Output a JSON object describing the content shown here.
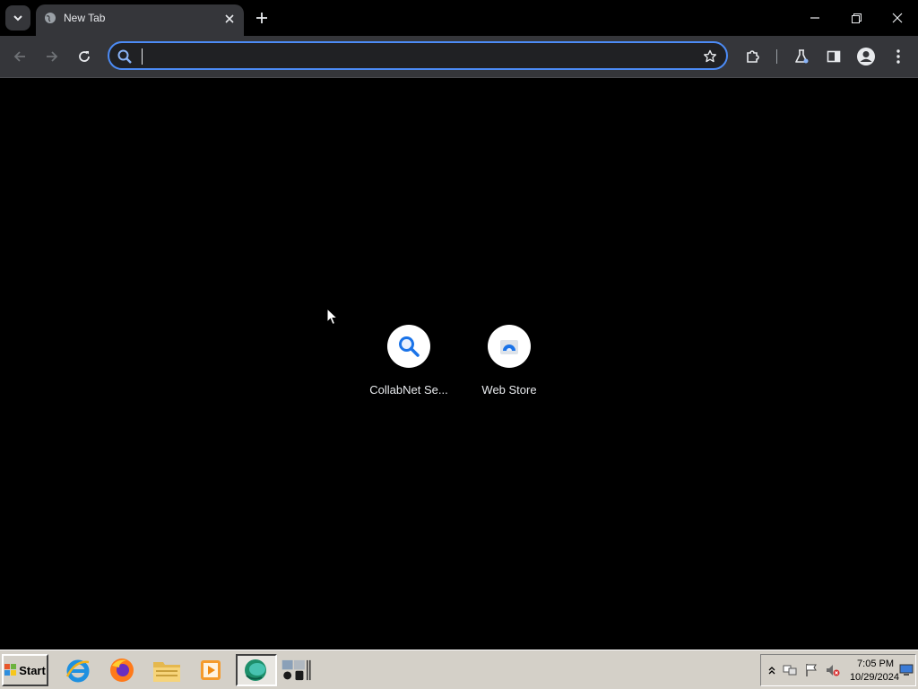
{
  "browser": {
    "tab": {
      "title": "New Tab"
    },
    "omnibox": {
      "value": "",
      "placeholder": ""
    }
  },
  "new_tab_page": {
    "shortcuts": [
      {
        "label": "CollabNet Se...",
        "icon": "search-icon"
      },
      {
        "label": "Web Store",
        "icon": "webstore-icon"
      }
    ]
  },
  "taskbar": {
    "start_label": "Start",
    "apps": [
      "internet-explorer-icon",
      "firefox-icon",
      "file-explorer-icon",
      "media-player-icon",
      "chrome-app-icon",
      "control-panel-icon"
    ],
    "clock": {
      "time": "7:05 PM",
      "date": "10/29/2024"
    }
  },
  "colors": {
    "accent": "#4c8bf5",
    "toolbar": "#35363a",
    "page_bg": "#000000",
    "taskbar": "#d4d0c8"
  }
}
